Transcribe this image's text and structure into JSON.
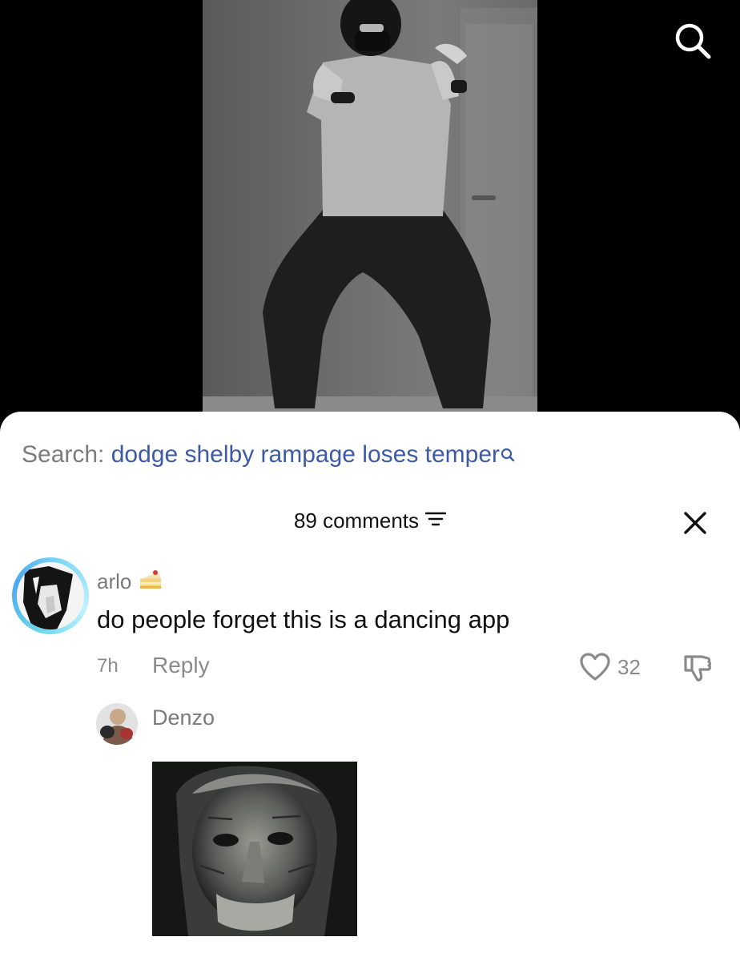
{
  "search": {
    "prefix": "Search:",
    "query": "dodge shelby rampage loses temper"
  },
  "comments": {
    "count_label": "89 comments"
  },
  "comment": {
    "username": "arlo",
    "text": "do people forget this is a dancing app",
    "time": "7h",
    "reply_label": "Reply",
    "like_count": "32"
  },
  "reply": {
    "username": "Denzo"
  },
  "icons": {
    "search": "search-icon",
    "close": "close-icon",
    "filter": "filter-icon",
    "heart": "heart-icon",
    "dislike": "thumbs-down-icon",
    "cake": "cake-icon"
  },
  "colors": {
    "link": "#3c5aa6",
    "muted": "#7b7b7b",
    "avatar_ring": "#6ad6e8"
  }
}
